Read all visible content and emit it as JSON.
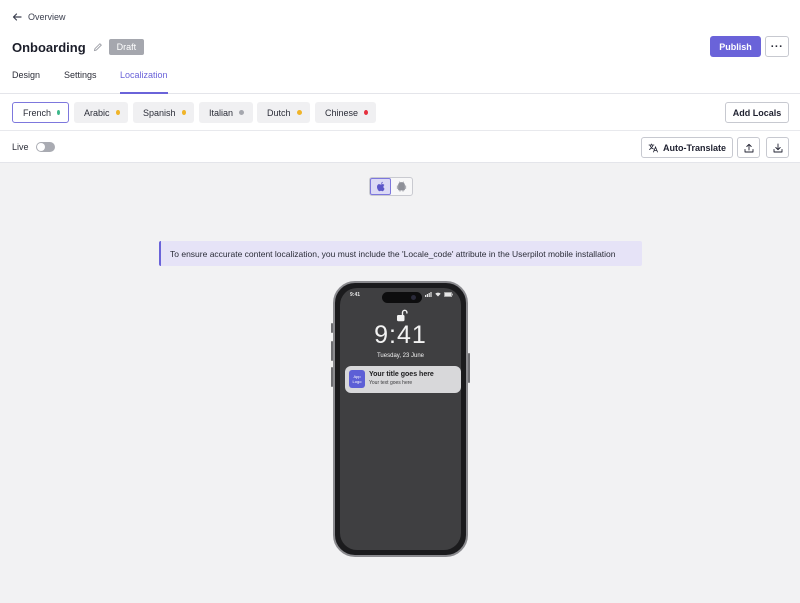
{
  "header": {
    "back_label": "Overview",
    "title": "Onboarding",
    "status_badge": "Draft",
    "publish_label": "Publish",
    "more_label": "···"
  },
  "tabs": [
    {
      "label": "Design",
      "active": false
    },
    {
      "label": "Settings",
      "active": false
    },
    {
      "label": "Localization",
      "active": true
    }
  ],
  "languages": [
    {
      "label": "French",
      "status_color": "#3db88a",
      "selected": true
    },
    {
      "label": "Arabic",
      "status_color": "#f0b429",
      "selected": false
    },
    {
      "label": "Spanish",
      "status_color": "#f0b429",
      "selected": false
    },
    {
      "label": "Italian",
      "status_color": "#a5a7ae",
      "selected": false
    },
    {
      "label": "Dutch",
      "status_color": "#f0b429",
      "selected": false
    },
    {
      "label": "Chinese",
      "status_color": "#e5303e",
      "selected": false
    }
  ],
  "actions": {
    "add_locals_label": "Add Locals",
    "auto_translate_label": "Auto-Translate",
    "upload_icon": "upload-icon",
    "download_icon": "download-icon"
  },
  "live": {
    "label": "Live",
    "enabled": false
  },
  "platforms": [
    {
      "icon": "apple-icon",
      "active": true
    },
    {
      "icon": "android-icon",
      "active": false
    }
  ],
  "info_banner": "To ensure accurate content localization, you must include the 'Locale_code' attribute in the Userpilot mobile installation",
  "preview": {
    "status_time": "9:41",
    "lock_time": "9:41",
    "lock_date": "Tuesday, 23 June",
    "notification": {
      "app_icon_text": "App Logo",
      "title": "Your title goes here",
      "text": "Your text goes here"
    }
  },
  "colors": {
    "accent": "#6a63d9",
    "badge_gray": "#a5a7ae"
  }
}
